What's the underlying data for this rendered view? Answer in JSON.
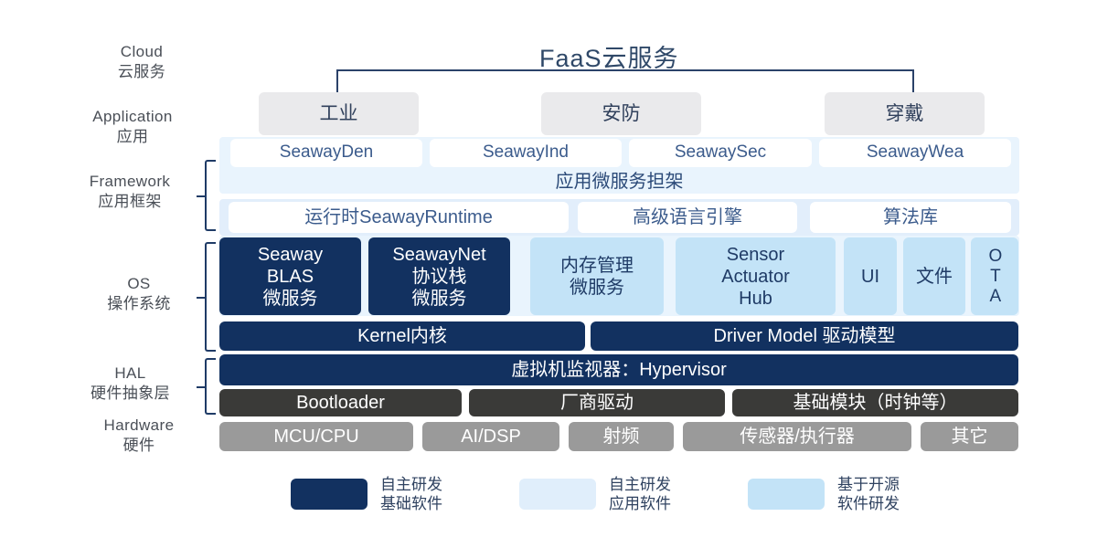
{
  "diagram": {
    "title": "FaaS云服务",
    "layers": [
      {
        "en": "Cloud",
        "cn": "云服务",
        "bracket": false
      },
      {
        "en": "Application",
        "cn": "应用",
        "bracket": false
      },
      {
        "en": "Framework",
        "cn": "应用框架",
        "bracket": true
      },
      {
        "en": "OS",
        "cn": "操作系统",
        "bracket": true
      },
      {
        "en": "HAL",
        "cn": "硬件抽象层",
        "bracket": true
      },
      {
        "en": "Hardware",
        "cn": "硬件",
        "bracket": false
      }
    ],
    "application_domains": [
      {
        "label": "工业"
      },
      {
        "label": "安防"
      },
      {
        "label": "穿戴"
      }
    ],
    "application_products": [
      {
        "label": "SeawayDen"
      },
      {
        "label": "SeawayInd"
      },
      {
        "label": "SeawaySec"
      },
      {
        "label": "SeawayWea"
      }
    ],
    "framework": {
      "scaffold": "应用微服务担架",
      "modules": [
        {
          "label": "运行时SeawayRuntime"
        },
        {
          "label": "高级语言引擎"
        },
        {
          "label": "算法库"
        }
      ]
    },
    "os": {
      "services": [
        {
          "label": "Seaway\nBLAS\n微服务",
          "kind": "navy"
        },
        {
          "label": "SeawayNet\n协议栈\n微服务",
          "kind": "navy"
        },
        {
          "label": "内存管理\n微服务",
          "kind": "lightblue"
        },
        {
          "label": "Sensor\nActuator\nHub",
          "kind": "lightblue"
        },
        {
          "label": "UI",
          "kind": "lightblue"
        },
        {
          "label": "文件",
          "kind": "lightblue"
        },
        {
          "label": "OTA",
          "kind": "lightblue-vertical"
        }
      ],
      "kernel_row": [
        {
          "label": "Kernel内核"
        },
        {
          "label": "Driver Model 驱动模型"
        }
      ]
    },
    "hal": {
      "hypervisor": "虚拟机监视器：Hypervisor",
      "modules": [
        {
          "label": "Bootloader"
        },
        {
          "label": "厂商驱动"
        },
        {
          "label": "基础模块（时钟等）"
        }
      ]
    },
    "hardware": {
      "modules": [
        {
          "label": "MCU/CPU"
        },
        {
          "label": "AI/DSP"
        },
        {
          "label": "射频"
        },
        {
          "label": "传感器/执行器"
        },
        {
          "label": "其它"
        }
      ]
    },
    "legend": [
      {
        "label": "自主研发\n基础软件",
        "color": "#123160"
      },
      {
        "label": "自主研发\n应用软件",
        "color": "#e0eefb"
      },
      {
        "label": "基于开源\n软件研发",
        "color": "#c3e3f7"
      }
    ],
    "colors": {
      "navy": "#123160",
      "light_blue": "#c3e3f7",
      "pale_blue": "#e5f1fb",
      "app_gray": "#eaeaec",
      "hal_gray": "#3a3a38",
      "hardware_gray": "#9a9a9a",
      "text_navy": "#1f3b66"
    }
  }
}
